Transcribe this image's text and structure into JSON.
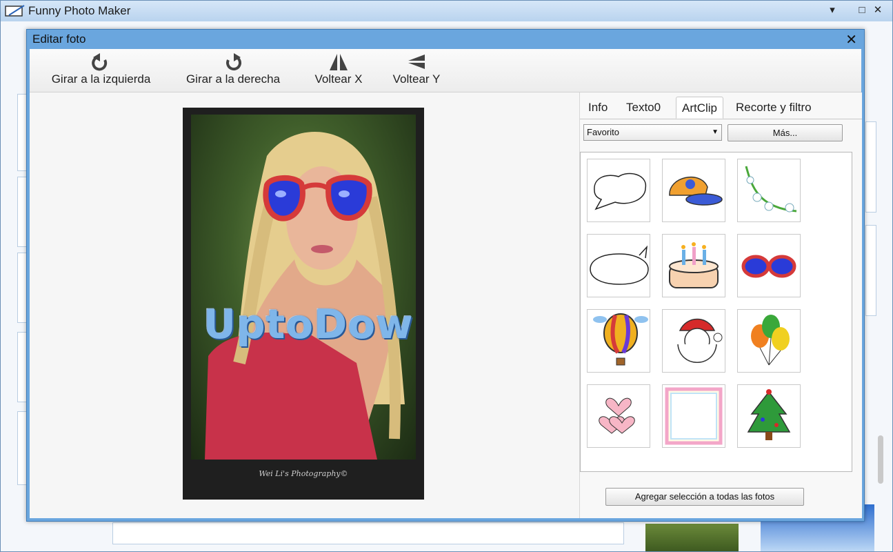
{
  "app": {
    "title": "Funny Photo Maker",
    "window_controls": [
      "▾",
      "□",
      "✕"
    ]
  },
  "dialog": {
    "title": "Editar foto",
    "close": "✕"
  },
  "toolbar": {
    "rotate_left": "Girar a la izquierda",
    "rotate_right": "Girar a la derecha",
    "flip_x": "Voltear X",
    "flip_y": "Voltear Y"
  },
  "photo": {
    "overlay_text": "UptoDown",
    "watermark": "Wei Li's Photography©"
  },
  "panel": {
    "tabs": [
      {
        "label": "Info",
        "active": false
      },
      {
        "label": "Texto0",
        "active": false
      },
      {
        "label": "ArtClip",
        "active": true
      },
      {
        "label": "Recorte y filtro",
        "active": false
      }
    ],
    "category_select": "Favorito",
    "more_button": "Más...",
    "add_button": "Agregar selección a todas las fotos",
    "clips": [
      "speech-bubble-icon",
      "cap-icon",
      "flowers-icon",
      "oval-bubble-icon",
      "birthday-cake-icon",
      "sunglasses-icon",
      "hot-air-balloon-icon",
      "santa-icon",
      "balloons-icon",
      "hearts-icon",
      "frame-icon",
      "christmas-tree-icon"
    ]
  },
  "colors": {
    "dialog_border": "#6aa6de",
    "accent_text": "#7fb6ea"
  }
}
